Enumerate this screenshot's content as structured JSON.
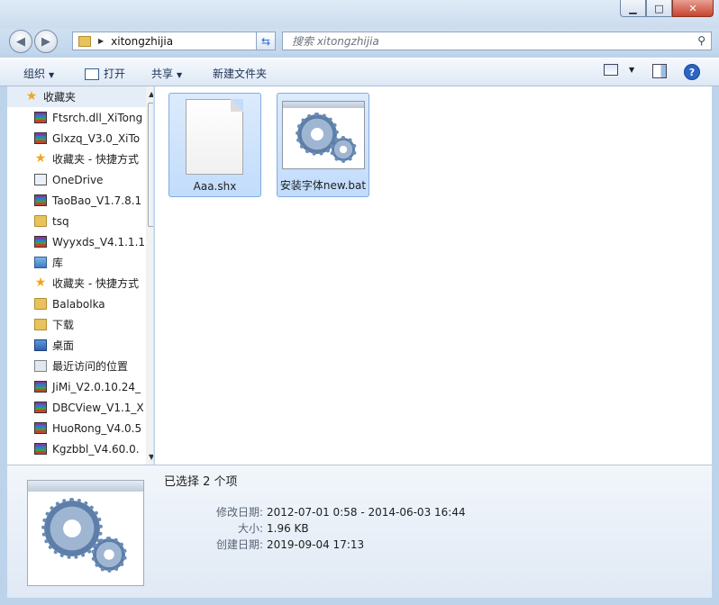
{
  "window": {
    "controls": {
      "minimize": "▁",
      "maximize": "□",
      "close": "✕"
    }
  },
  "nav": {
    "back_icon": "◀",
    "forward_icon": "▶",
    "address": {
      "path": "xitongzhijia"
    },
    "refresh_icon": "⇆",
    "search": {
      "placeholder": "搜索 xitongzhijia"
    }
  },
  "toolbar": {
    "organize": "组织",
    "open": "打开",
    "share": "共享",
    "new_folder": "新建文件夹",
    "help": "?"
  },
  "sidebar": {
    "items": [
      {
        "label": "收藏夹",
        "icon": "star-icon"
      },
      {
        "label": "Ftsrch.dll_XiTong",
        "icon": "winrar-icon"
      },
      {
        "label": "Glxzq_V3.0_XiTo",
        "icon": "winrar-icon"
      },
      {
        "label": "收藏夹 - 快捷方式",
        "icon": "star-icon"
      },
      {
        "label": "OneDrive",
        "icon": "onedrive-icon"
      },
      {
        "label": "TaoBao_V1.7.8.1",
        "icon": "winrar-icon"
      },
      {
        "label": "tsq",
        "icon": "folder-icon"
      },
      {
        "label": "Wyyxds_V4.1.1.1",
        "icon": "winrar-icon"
      },
      {
        "label": "库",
        "icon": "library-icon"
      },
      {
        "label": "收藏夹 - 快捷方式",
        "icon": "star-icon"
      },
      {
        "label": "Balabolka",
        "icon": "folder-icon"
      },
      {
        "label": "下载",
        "icon": "download-icon"
      },
      {
        "label": "桌面",
        "icon": "desktop-icon"
      },
      {
        "label": "最近访问的位置",
        "icon": "recent-icon"
      },
      {
        "label": "JiMi_V2.0.10.24_",
        "icon": "winrar-icon"
      },
      {
        "label": "DBCView_V1.1_X",
        "icon": "winrar-icon"
      },
      {
        "label": "HuoRong_V4.0.5",
        "icon": "winrar-icon"
      },
      {
        "label": "Kgzbbl_V4.60.0.",
        "icon": "winrar-icon"
      }
    ]
  },
  "files": [
    {
      "name": "Aaa.shx",
      "icon": "blank-document-icon",
      "selected": true
    },
    {
      "name": "安装字体new.bat",
      "icon": "batch-file-gear-icon",
      "selected": true
    }
  ],
  "details": {
    "selected_count": "已选择 2 个项",
    "modified_label": "修改日期:",
    "modified_value": "2012-07-01 0:58 - 2014-06-03 16:44",
    "size_label": "大小:",
    "size_value": "1.96 KB",
    "created_label": "创建日期:",
    "created_value": "2019-09-04 17:13"
  }
}
